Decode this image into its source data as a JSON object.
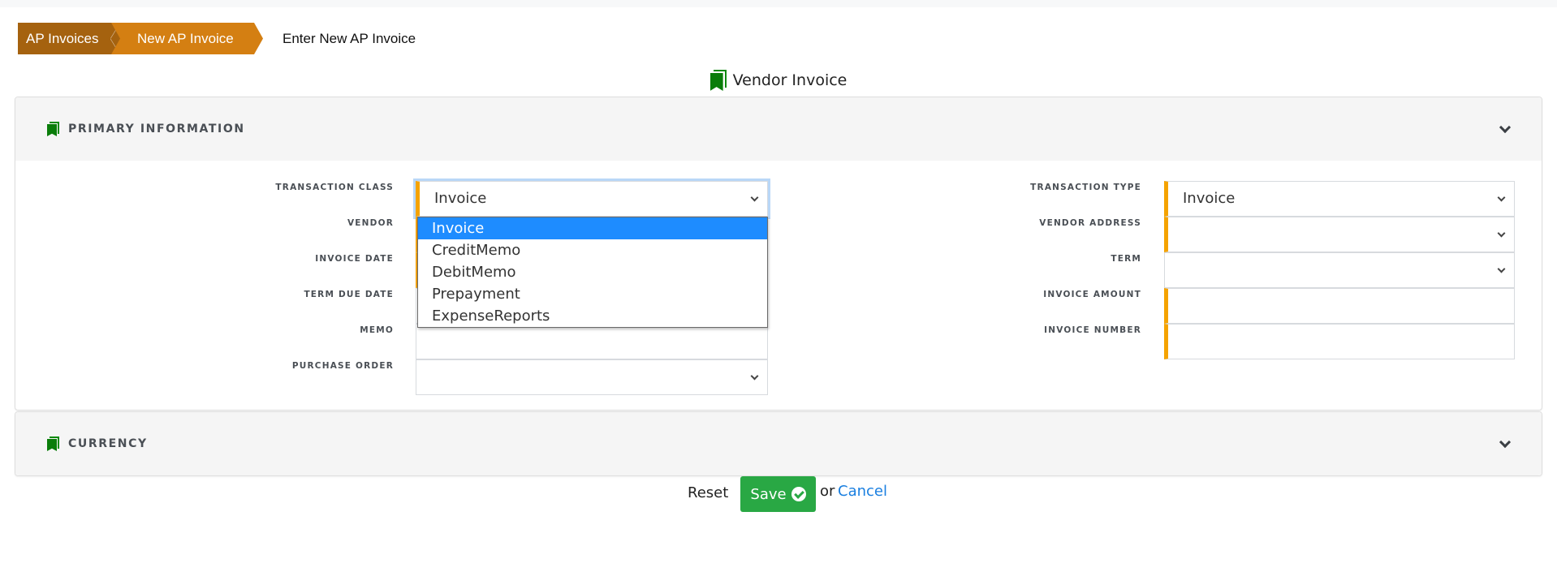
{
  "breadcrumb": {
    "items": [
      {
        "label": "AP Invoices"
      },
      {
        "label": "New AP Invoice"
      }
    ],
    "current": "Enter New AP Invoice"
  },
  "page_title": "Vendor Invoice",
  "colors": {
    "crumb_dark": "#a5620f",
    "crumb_light": "#d47f12",
    "required_marker": "#f5a300",
    "icon_green": "#0a7d0a",
    "save_green": "#29a844",
    "link_blue": "#1a7fe0",
    "option_selected": "#1e8cff"
  },
  "sections": {
    "primary": {
      "title": "PRIMARY INFORMATION",
      "icon": "bookmark-icon",
      "expanded": true,
      "left_fields": [
        {
          "label": "TRANSACTION CLASS",
          "type": "select",
          "value": "Invoice",
          "required": true,
          "focused": true
        },
        {
          "label": "VENDOR",
          "type": "select",
          "value": "",
          "required": true
        },
        {
          "label": "INVOICE DATE",
          "type": "date",
          "value": "",
          "required": true
        },
        {
          "label": "TERM DUE DATE",
          "type": "date",
          "value": "",
          "required": false
        },
        {
          "label": "MEMO",
          "type": "text",
          "value": "",
          "required": false
        },
        {
          "label": "PURCHASE ORDER",
          "type": "select",
          "value": "",
          "required": false
        }
      ],
      "right_fields": [
        {
          "label": "TRANSACTION TYPE",
          "type": "select",
          "value": "Invoice",
          "required": true
        },
        {
          "label": "VENDOR ADDRESS",
          "type": "select",
          "value": "",
          "required": true
        },
        {
          "label": "TERM",
          "type": "select",
          "value": "",
          "required": false
        },
        {
          "label": "INVOICE AMOUNT",
          "type": "text",
          "value": "",
          "required": true
        },
        {
          "label": "INVOICE NUMBER",
          "type": "text",
          "value": "",
          "required": true
        }
      ],
      "transaction_class_options": [
        "Invoice",
        "CreditMemo",
        "DebitMemo",
        "Prepayment",
        "ExpenseReports"
      ],
      "transaction_class_selected": "Invoice"
    },
    "currency": {
      "title": "CURRENCY",
      "icon": "bookmark-icon",
      "expanded": false
    }
  },
  "footer": {
    "reset_label": "Reset",
    "save_label": "Save",
    "or_label": "or",
    "cancel_label": "Cancel"
  }
}
